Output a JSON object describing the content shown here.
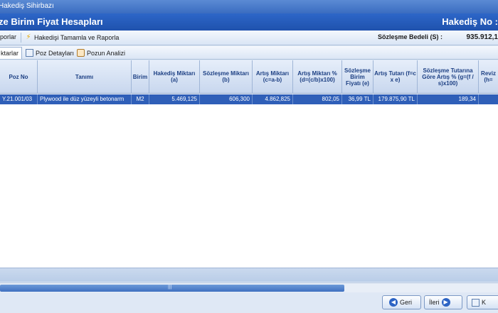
{
  "window": {
    "title": "Hakediş Sihirbazı"
  },
  "banner": {
    "title": "ze Birim Fiyat Hesapları",
    "hakedis_label": "Hakediş No :"
  },
  "toolbar": {
    "reports_label": "porlar",
    "complete_label": "Hakedişi Tamamla ve Raporla",
    "contract_label": "Sözleşme Bedeli (S) :",
    "contract_value": "935.912,1"
  },
  "tabs": {
    "active_label": "ktarlar",
    "details_label": "Poz Detayları",
    "analysis_label": "Pozun Analizi"
  },
  "table": {
    "headers": {
      "poz_no": "Poz No",
      "tanimi": "Tanımı",
      "birim": "Birim",
      "hakedis": "Hakediş Miktarı (a)",
      "sozlesme": "Sözleşme Miktarı (b)",
      "artis": "Artış Miktarı (c=a-b)",
      "artis_pct": "Artış Miktarı % (d=(c/b)x100)",
      "birim_fiyat": "Sözleşme Birim Fiyatı (e)",
      "artis_tutari": "Artış Tutarı (f=c x e)",
      "tutar_artis": "Sözleşme Tutarına Göre Artış % (g=(f / s)x100)",
      "revize": "Reviz (h="
    },
    "row": {
      "poz_no": "Y.21.001/03",
      "tanimi": "Plywood ile düz yüzeyli betonarm",
      "birim": "M2",
      "hakedis": "5.469,125",
      "sozlesme": "606,300",
      "artis": "4.862,825",
      "artis_pct": "802,05",
      "birim_fiyat": "36,99 TL",
      "artis_tutari": "179.875,90 TL",
      "tutar_artis": "189,34",
      "revize": ""
    }
  },
  "buttons": {
    "back": "Geri",
    "next": "İleri",
    "close": "K"
  }
}
